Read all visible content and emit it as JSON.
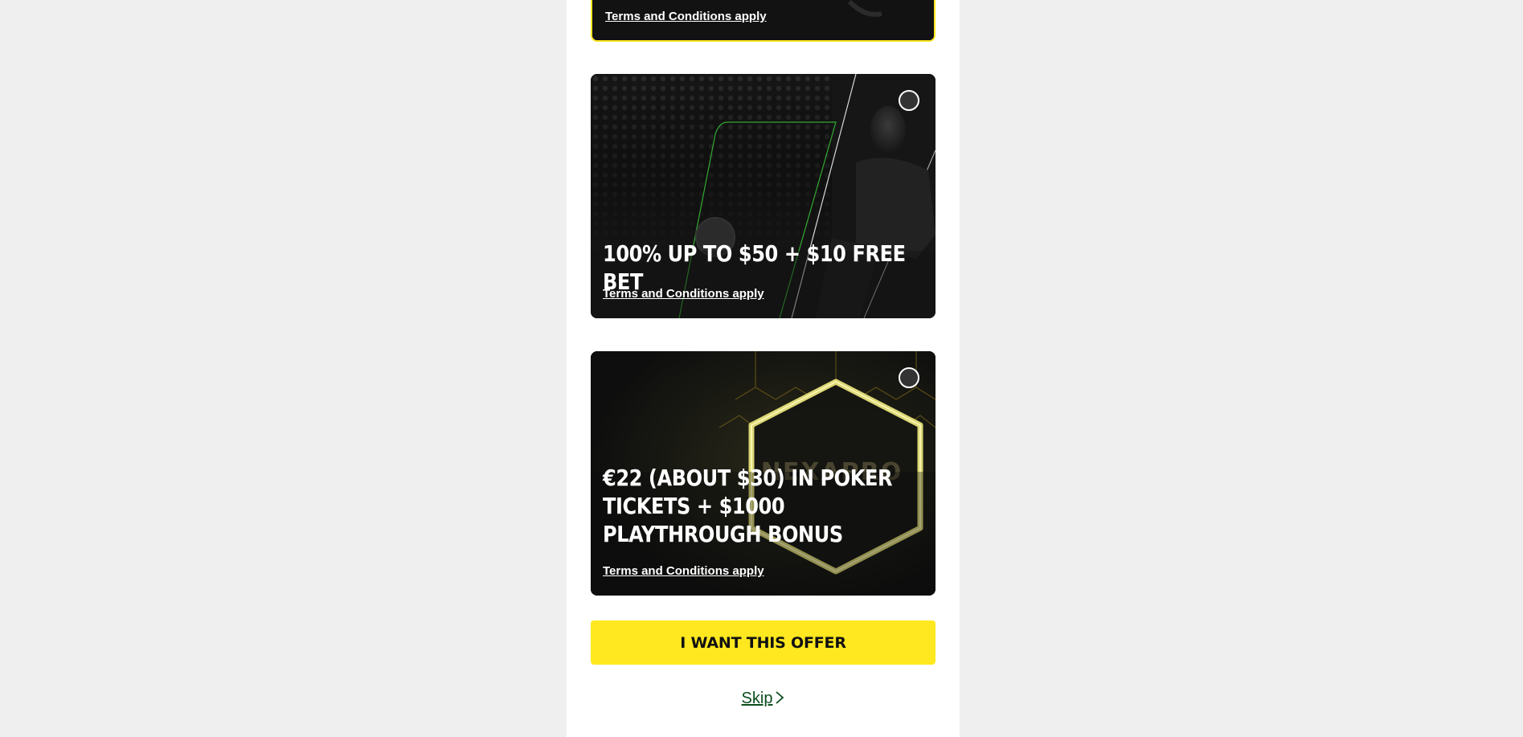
{
  "offers": [
    {
      "title": "",
      "terms": "Terms and Conditions apply",
      "selected": true
    },
    {
      "title": "100% UP TO $50 + $10 FREE BET",
      "terms": "Terms and Conditions apply",
      "selected": false
    },
    {
      "title": "€22 (ABOUT $30) IN POKER TICKETS + $1000 PLAYTHROUGH BONUS",
      "terms": "Terms and Conditions apply",
      "selected": false
    }
  ],
  "cta_label": "I WANT THIS OFFER",
  "skip_label": "Skip",
  "colors": {
    "accent": "#ffe81f",
    "card_bg": "#111111",
    "skip_text": "#0b4d1d",
    "neon_green": "#3bd13b"
  },
  "icons": {
    "skip": "chevron-right-icon",
    "radio": "radio-unselected-icon"
  }
}
